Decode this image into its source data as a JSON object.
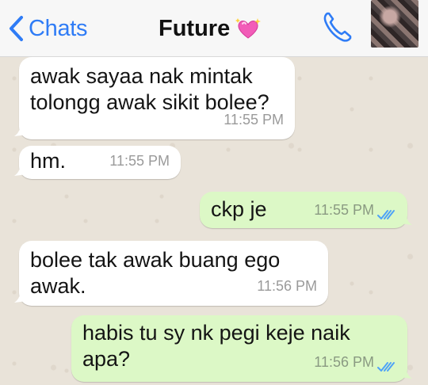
{
  "navbar": {
    "back_label": "Chats",
    "title": "Future",
    "accent_color": "#2f7cf6"
  },
  "messages": [
    {
      "direction": "in",
      "text": "awak sayaa nak mintak\ntolongg awak sikit bolee?",
      "time": "11:55 PM"
    },
    {
      "direction": "in",
      "text": "hm.",
      "time": "11:55 PM"
    },
    {
      "direction": "out",
      "text": "ckp je",
      "time": "11:55 PM",
      "status": "read-double-check"
    },
    {
      "direction": "in",
      "text": "bolee tak awak buang ego\nawak.",
      "time": "11:56 PM"
    },
    {
      "direction": "out",
      "text": "habis tu sy nk pegi keje naik\napa?",
      "time": "11:56 PM",
      "status": "read-double-check"
    }
  ],
  "icons": {
    "back": "chevron-left-icon",
    "title_emoji": "sparkling-heart-icon",
    "call": "phone-icon"
  },
  "colors": {
    "incoming_bubble": "#ffffff",
    "outgoing_bubble": "#dcf8c6",
    "read_ticks": "#4fa3f7"
  }
}
